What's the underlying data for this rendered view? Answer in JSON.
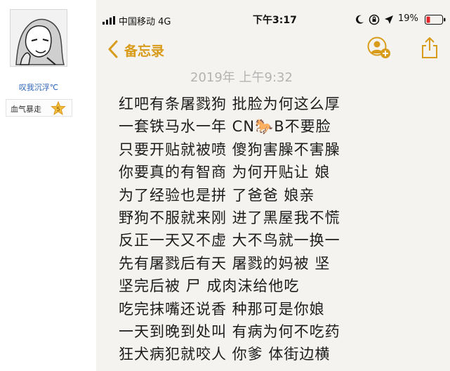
{
  "sidebar": {
    "username": "叹我沉浮℃",
    "badge_label": "血气暴走",
    "badge_level": "5"
  },
  "phone": {
    "status": {
      "carrier": "中国移动  4G",
      "time": "下午3:17",
      "battery": "19%"
    },
    "nav": {
      "back_label": "备忘录"
    },
    "note": {
      "date_line": "2019年          上午9:32",
      "lines": [
        "红吧有条屠戮狗 批脸为何这么厚",
        "一套铁马水一年 CN🐎B不要脸",
        "只要开贴就被喷 傻狗害臊不害臊",
        "你要真的有智商 为何开贴让  娘",
        "为了经验也是拼  了爸爸  娘亲",
        "野狗不服就来刚 进了黑屋我不慌",
        "反正一天又不虚 大不鸟就一换一",
        "先有屠戮后有天 屠戮的妈被  坚",
        "  坚完后被  尸  成肉沫给他吃",
        "吃完抹嘴还说香  种那可是你娘",
        "一天到晚到处叫 有病为何不吃药",
        "狂犬病犯就咬人 你爹  体街边横"
      ]
    }
  },
  "colors": {
    "accent": "#d99b1a",
    "link": "#2a62b8",
    "note_bg": "#f4f3ef"
  }
}
